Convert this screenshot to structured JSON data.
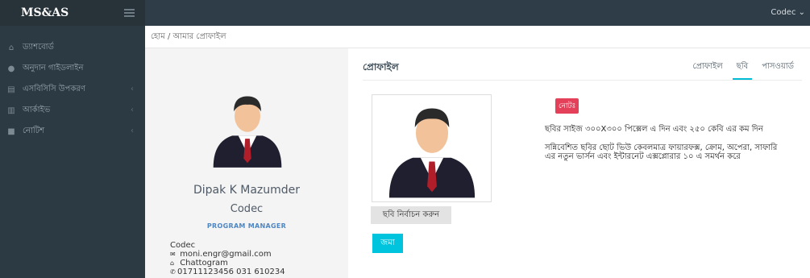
{
  "app": {
    "brand": "MS&AS",
    "user": "Codec ⌄"
  },
  "sidebar": {
    "items": [
      {
        "label": "ড্যাশবোর্ড",
        "icon": "home-icon"
      },
      {
        "label": "অনুদান গাইডলাইন",
        "icon": "circle-icon"
      },
      {
        "label": "এসবিসিসি উপকরণ",
        "icon": "file-icon"
      },
      {
        "label": "আর্কাইভ",
        "icon": "archive-icon"
      },
      {
        "label": "নোটিশ",
        "icon": "notice-icon"
      }
    ]
  },
  "breadcrumb": "হোম / আমার প্রোফাইল",
  "profile": {
    "name": "Dipak K Mazumder",
    "company": "Codec",
    "role": "PROGRAM MANAGER",
    "contact_company": "Codec",
    "email": "moni.engr@gmail.com",
    "city": "Chattogram",
    "phone": "01711123456 031 610234"
  },
  "panel": {
    "title": "প্রোফাইল",
    "tabs": [
      "প্রোফাইল",
      "ছবি",
      "পাসওয়ার্ড"
    ],
    "active_tab": "ছবি",
    "select_button": "ছবি নির্বাচন করুন",
    "submit_button": "জমা",
    "note_label": "নোটঃ",
    "note_size": "ছবির সাইজ ৩০০X৩০০ পিক্সেল এ দিন এবং ২৫০ কেবি এর কম দিন",
    "note_browser": "সন্নিবেশিত ছবির ছোট ভিউ কেবলমাত্র ফায়ারফক্স, ক্রোম, অপেরা, সাফারি এর নতুন ভার্সন এবং ইন্টারনেট এক্সপ্লোরার ১০ এ সমর্থন করে"
  },
  "colors": {
    "topbar": "#2f3d48",
    "sidebar": "#2c3a43",
    "accent": "#00bcd4",
    "badge": "#e4405a",
    "role": "#4f87c4"
  }
}
